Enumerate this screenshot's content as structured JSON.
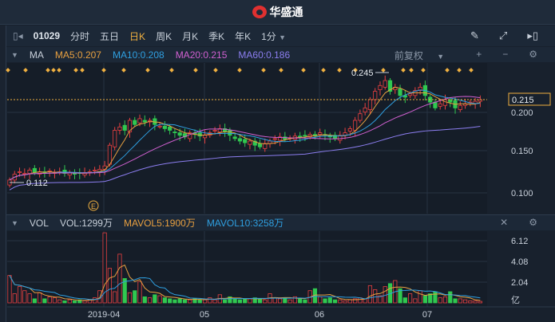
{
  "app": {
    "brand": "华盛通"
  },
  "toolbar": {
    "code": "01029",
    "periods": [
      "分时",
      "五日",
      "日K",
      "周K",
      "月K",
      "季K",
      "年K"
    ],
    "active": "日K",
    "interval": "1分"
  },
  "ma_row": {
    "label": "MA",
    "ma5": "MA5:0.207",
    "ma10": "MA10:0.208",
    "ma20": "MA20:0.215",
    "ma60": "MA60:0.186",
    "adjust": "前复权"
  },
  "vol_row": {
    "label": "VOL",
    "vol": "VOL:1299万",
    "mavol5": "MAVOL5:1900万",
    "mavol10": "MAVOL10:3258万"
  },
  "colors": {
    "ma5": "#e8a040",
    "ma10": "#2f9fe0",
    "ma20": "#d060d0",
    "ma60": "#8c7ef0",
    "up": "#e84040",
    "down": "#30c850",
    "accent": "#f0b040"
  },
  "price_axis": [
    "0.215",
    "0.200",
    "0.150",
    "0.100"
  ],
  "vol_axis": [
    "6.12",
    "4.08",
    "2.04",
    "亿"
  ],
  "date_axis": [
    "2019-04",
    "05",
    "06",
    "07"
  ],
  "annotations": {
    "high": "0.245",
    "low": "0.112",
    "last": "0.215",
    "event": "E"
  },
  "chart_data": {
    "type": "candlestick",
    "closes": [
      0.118,
      0.125,
      0.128,
      0.126,
      0.13,
      0.127,
      0.128,
      0.126,
      0.129,
      0.127,
      0.128,
      0.126,
      0.127,
      0.125,
      0.126,
      0.127,
      0.128,
      0.13,
      0.131,
      0.135,
      0.16,
      0.178,
      0.182,
      0.178,
      0.19,
      0.185,
      0.192,
      0.188,
      0.19,
      0.185,
      0.183,
      0.18,
      0.178,
      0.175,
      0.172,
      0.17,
      0.175,
      0.173,
      0.171,
      0.172,
      0.175,
      0.178,
      0.18,
      0.176,
      0.172,
      0.168,
      0.165,
      0.163,
      0.165,
      0.16,
      0.158,
      0.162,
      0.165,
      0.168,
      0.17,
      0.167,
      0.169,
      0.171,
      0.17,
      0.172,
      0.173,
      0.171,
      0.175,
      0.172,
      0.17,
      0.168,
      0.172,
      0.175,
      0.18,
      0.19,
      0.198,
      0.205,
      0.215,
      0.225,
      0.232,
      0.238,
      0.225,
      0.23,
      0.22,
      0.218,
      0.222,
      0.226,
      0.23,
      0.22,
      0.212,
      0.205,
      0.21,
      0.215,
      0.212,
      0.205,
      0.208,
      0.21,
      0.212,
      0.213,
      0.215
    ],
    "volumes": [
      2.7,
      0.9,
      1.6,
      1.2,
      0.9,
      0.4,
      1.0,
      0.4,
      0.6,
      0.5,
      0.3,
      0.2,
      0.3,
      0.2,
      0.3,
      0.2,
      0.3,
      0.5,
      1.2,
      6.9,
      3.4,
      1.1,
      4.8,
      2.4,
      1.0,
      1.2,
      2.1,
      0.6,
      0.5,
      0.8,
      0.7,
      0.5,
      0.4,
      0.3,
      0.4,
      0.3,
      0.3,
      0.4,
      0.3,
      0.3,
      0.5,
      0.3,
      0.8,
      0.3,
      0.6,
      0.4,
      0.3,
      0.4,
      0.4,
      0.5,
      0.4,
      0.3,
      0.9,
      0.5,
      0.4,
      0.5,
      0.3,
      0.6,
      0.4,
      0.3,
      1.2,
      1.4,
      0.6,
      0.4,
      0.5,
      0.3,
      0.3,
      0.2,
      0.3,
      0.4,
      0.5,
      0.4,
      1.7,
      1.3,
      0.7,
      1.6,
      1.9,
      2.2,
      1.4,
      0.5,
      0.9,
      0.4,
      1.2,
      0.7,
      0.9,
      1.1,
      0.5,
      0.6,
      1.1,
      0.4,
      0.4,
      0.3,
      0.2,
      0.2,
      0.15
    ],
    "price_range": [
      0.09,
      0.255
    ],
    "vol_range": [
      0,
      6.9
    ]
  }
}
